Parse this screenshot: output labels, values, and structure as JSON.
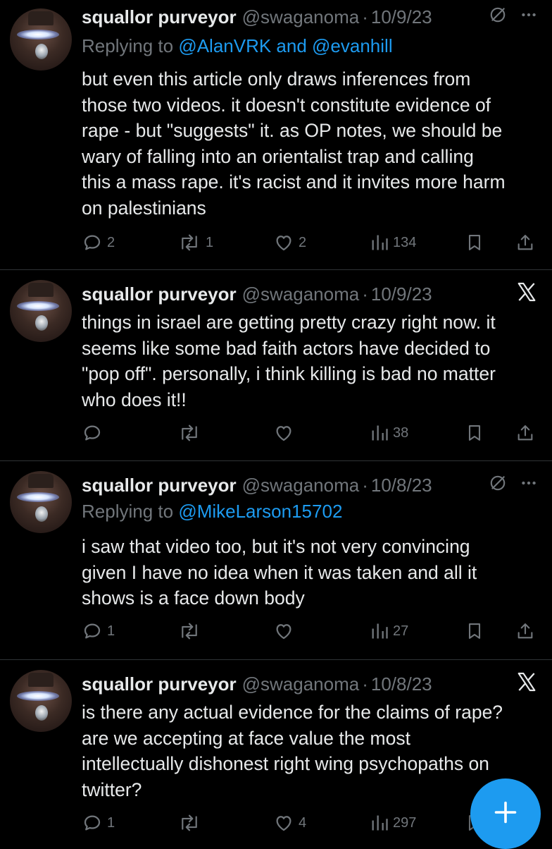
{
  "tweets": [
    {
      "name": "squallor purveyor",
      "handle": "@swaganoma",
      "dot": "·",
      "date": "10/9/23",
      "reply_prefix": "Replying to ",
      "reply_targets": "@AlanVRK and @evanhill",
      "text": "but even this article only draws inferences from\nthose two videos. it doesn't constitute evidence of\nrape - but \"suggests\" it. as OP notes, we should be\nwary of falling into an orientalist trap and calling\nthis a mass rape. it's racist and it invites more harm\non palestinians",
      "replies": "2",
      "retweets": "1",
      "likes": "2",
      "views": "134",
      "top_icon": "slash-circle-icon",
      "has_more": true
    },
    {
      "name": "squallor purveyor",
      "handle": "@swaganoma",
      "dot": "·",
      "date": "10/9/23",
      "text": "things in israel are getting pretty crazy right now. it\nseems like some bad faith actors have decided to\n\"pop off\". personally, i think killing is bad no matter\nwho does it!!",
      "replies": "",
      "retweets": "",
      "likes": "",
      "views": "38",
      "top_icon": "x-logo-icon"
    },
    {
      "name": "squallor purveyor",
      "handle": "@swaganoma",
      "dot": "·",
      "date": "10/8/23",
      "reply_prefix": "Replying to ",
      "reply_targets": "@MikeLarson15702",
      "text": "i saw that video too, but it's not very convincing\ngiven I have no idea when it was taken and all it\nshows is a face down body",
      "replies": "1",
      "retweets": "",
      "likes": "",
      "views": "27",
      "top_icon": "slash-circle-icon",
      "has_more": true
    },
    {
      "name": "squallor purveyor",
      "handle": "@swaganoma",
      "dot": "·",
      "date": "10/8/23",
      "text": "is there any actual evidence for the claims of rape?\nare we accepting at face value the most\nintellectually dishonest right wing psychopaths on\ntwitter?",
      "replies": "1",
      "retweets": "",
      "likes": "4",
      "views": "297",
      "top_icon": "x-logo-icon"
    }
  ],
  "colors": {
    "background": "#000000",
    "text": "#e7e9ea",
    "muted": "#71767b",
    "link": "#1d9bf0",
    "divider": "#2f3336",
    "fab": "#1d9bf0"
  },
  "fab_icon": "plus-icon"
}
